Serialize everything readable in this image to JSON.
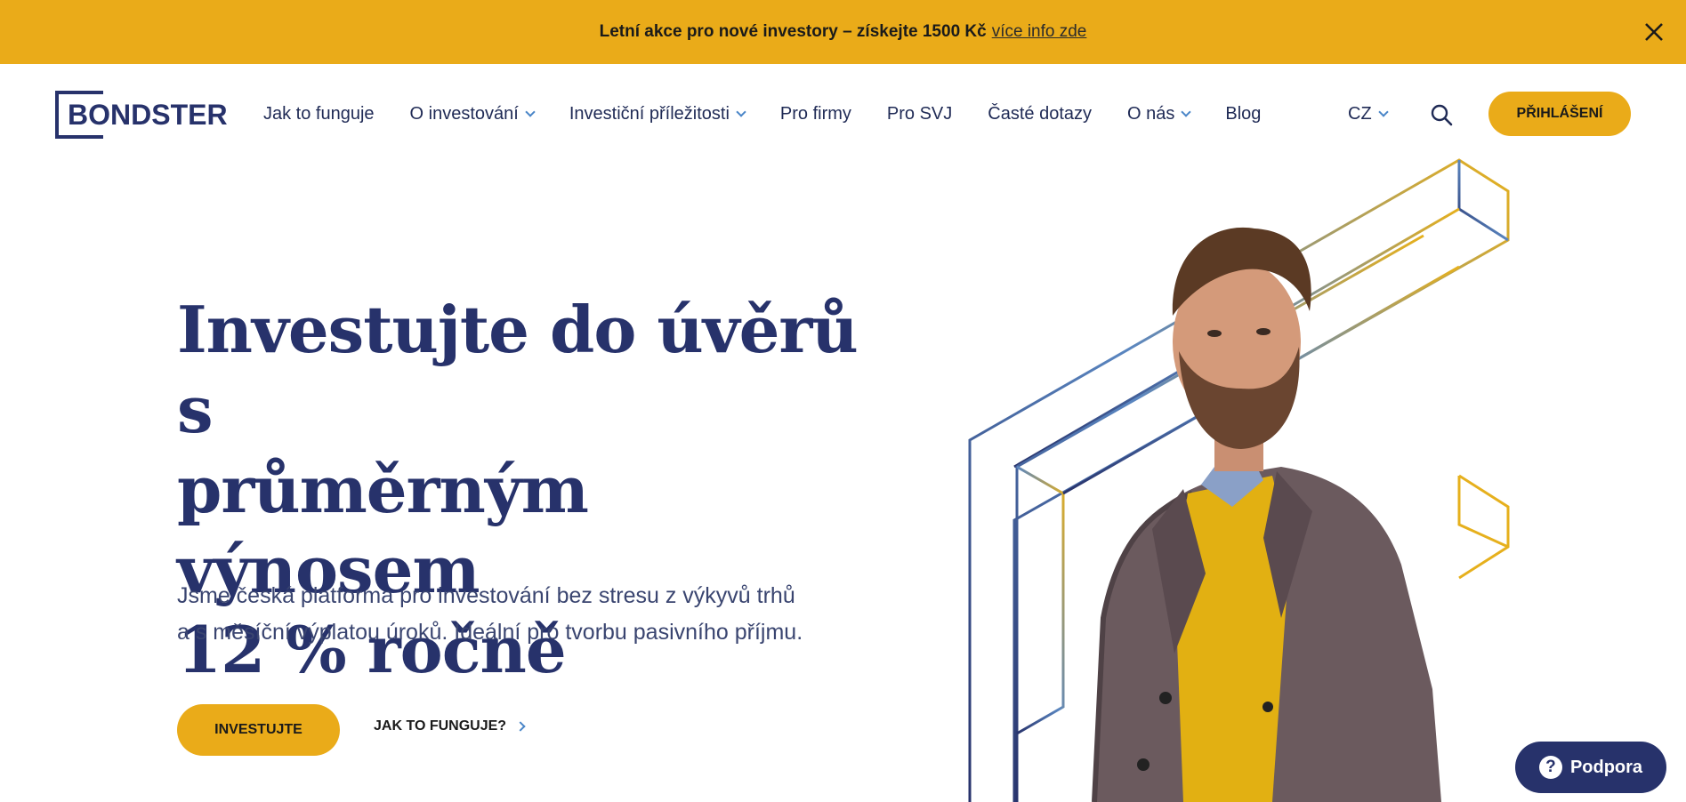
{
  "promo": {
    "text": "Letní akce pro nové investory – získejte 1500 Kč",
    "link": "více info zde",
    "close_icon": "close-icon"
  },
  "header": {
    "logo": "BONDSTER",
    "nav": [
      {
        "label": "Jak to funguje",
        "dropdown": false
      },
      {
        "label": "O investování",
        "dropdown": true
      },
      {
        "label": "Investiční příležitosti",
        "dropdown": true
      },
      {
        "label": "Pro firmy",
        "dropdown": false
      },
      {
        "label": "Pro SVJ",
        "dropdown": false
      },
      {
        "label": "Časté dotazy",
        "dropdown": false
      },
      {
        "label": "O nás",
        "dropdown": true
      },
      {
        "label": "Blog",
        "dropdown": false
      }
    ],
    "lang": "CZ",
    "search_icon": "search-icon",
    "login": "PŘIHLÁŠENÍ"
  },
  "hero": {
    "title_line1": "Investujte do úvěrů s",
    "title_line2": "průměrným výnosem",
    "title_line3": "12 % ročně",
    "subtitle_line1": "Jsme česká platforma pro investování bez stresu z výkyvů trhů",
    "subtitle_line2": "a s měsíční výplatou úroků. Ideální pro tvorbu pasivního příjmu.",
    "cta_primary": "INVESTUJTE",
    "cta_secondary": "JAK TO FUNGUJE?"
  },
  "support": {
    "label": "Podpora",
    "icon": "?"
  },
  "colors": {
    "accent": "#eaab19",
    "navy": "#27326b",
    "link_blue": "#4a86c8"
  }
}
